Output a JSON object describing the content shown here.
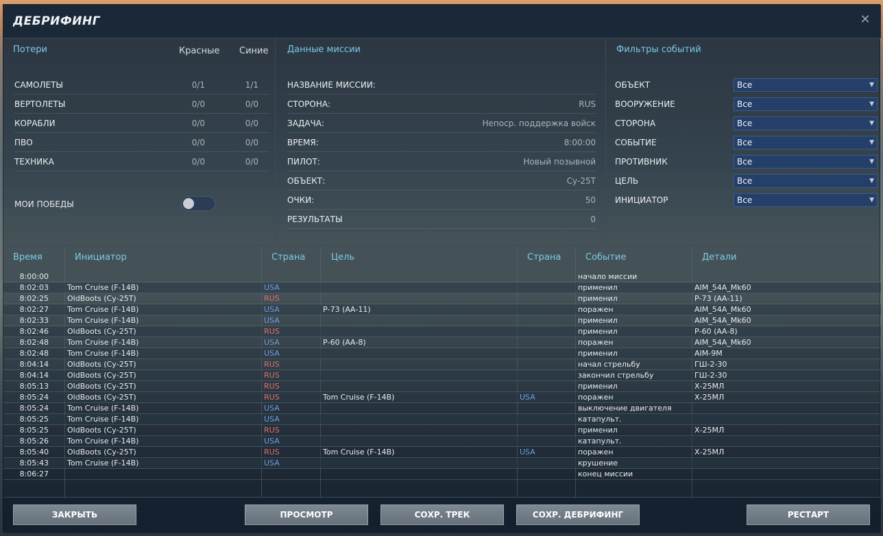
{
  "window": {
    "title": "ДЕБРИФИНГ",
    "close_icon": "close-icon"
  },
  "losses": {
    "header": "Потери",
    "red_label": "Красные",
    "blue_label": "Синие",
    "rows": [
      {
        "label": "САМОЛЕТЫ",
        "red": "0/1",
        "blue": "1/1"
      },
      {
        "label": "ВЕРТОЛЕТЫ",
        "red": "0/0",
        "blue": "0/0"
      },
      {
        "label": "КОРАБЛИ",
        "red": "0/0",
        "blue": "0/0"
      },
      {
        "label": "ПВО",
        "red": "0/0",
        "blue": "0/0"
      },
      {
        "label": "ТЕХНИКА",
        "red": "0/0",
        "blue": "0/0"
      }
    ],
    "my_wins_label": "МОИ ПОБЕДЫ",
    "my_wins_on": false
  },
  "mission": {
    "header": "Данные миссии",
    "rows": [
      {
        "label": "НАЗВАНИЕ МИССИИ:",
        "value": ""
      },
      {
        "label": "СТОРОНА:",
        "value": "RUS"
      },
      {
        "label": "ЗАДАЧА:",
        "value": "Непоср. поддержка войск"
      },
      {
        "label": "ВРЕМЯ:",
        "value": "8:00:00"
      },
      {
        "label": "ПИЛОТ:",
        "value": "Новый позывной"
      },
      {
        "label": "ОБЪЕКТ:",
        "value": "Су-25Т"
      },
      {
        "label": "ОЧКИ:",
        "value": "50"
      },
      {
        "label": "РЕЗУЛЬТАТЫ",
        "value": "0"
      }
    ]
  },
  "filters": {
    "header": "Фильтры событий",
    "rows": [
      {
        "label": "ОБЪЕКТ",
        "value": "Все"
      },
      {
        "label": "ВООРУЖЕНИЕ",
        "value": "Все"
      },
      {
        "label": "СТОРОНА",
        "value": "Все"
      },
      {
        "label": "СОБЫТИЕ",
        "value": "Все"
      },
      {
        "label": "ПРОТИВНИК",
        "value": "Все"
      },
      {
        "label": "ЦЕЛЬ",
        "value": "Все"
      },
      {
        "label": "ИНИЦИАТОР",
        "value": "Все"
      }
    ]
  },
  "events": {
    "headers": {
      "time": "Время",
      "initiator": "Инициатор",
      "country": "Страна",
      "target": "Цель",
      "target_country": "Страна",
      "event": "Событие",
      "details": "Детали"
    },
    "rows": [
      {
        "time": "8:00:00",
        "initiator": "",
        "country": "",
        "target": "",
        "target_country": "",
        "event": "начало миссии",
        "details": ""
      },
      {
        "time": "8:02:03",
        "initiator": "Tom Cruise (F-14B)",
        "country": "USA",
        "target": "",
        "target_country": "",
        "event": "применил",
        "details": "AIM_54A_Mk60"
      },
      {
        "time": "8:02:25",
        "initiator": "OldBoots (Су-25Т)",
        "country": "RUS",
        "target": "",
        "target_country": "",
        "event": "применил",
        "details": "Р-73 (АА-11)"
      },
      {
        "time": "8:02:27",
        "initiator": "Tom Cruise (F-14B)",
        "country": "USA",
        "target": "Р-73 (АА-11)",
        "target_country": "",
        "event": "поражен",
        "details": "AIM_54A_Mk60"
      },
      {
        "time": "8:02:33",
        "initiator": "Tom Cruise (F-14B)",
        "country": "USA",
        "target": "",
        "target_country": "",
        "event": "применил",
        "details": "AIM_54A_Mk60"
      },
      {
        "time": "8:02:46",
        "initiator": "OldBoots (Су-25Т)",
        "country": "RUS",
        "target": "",
        "target_country": "",
        "event": "применил",
        "details": "Р-60 (АА-8)"
      },
      {
        "time": "8:02:48",
        "initiator": "Tom Cruise (F-14B)",
        "country": "USA",
        "target": "Р-60 (АА-8)",
        "target_country": "",
        "event": "поражен",
        "details": "AIM_54A_Mk60"
      },
      {
        "time": "8:02:48",
        "initiator": "Tom Cruise (F-14B)",
        "country": "USA",
        "target": "",
        "target_country": "",
        "event": "применил",
        "details": "AIM-9M"
      },
      {
        "time": "8:04:14",
        "initiator": "OldBoots (Су-25Т)",
        "country": "RUS",
        "target": "",
        "target_country": "",
        "event": "начал стрельбу",
        "details": "ГШ-2-30"
      },
      {
        "time": "8:04:14",
        "initiator": "OldBoots (Су-25Т)",
        "country": "RUS",
        "target": "",
        "target_country": "",
        "event": "закончил стрельбу",
        "details": "ГШ-2-30"
      },
      {
        "time": "8:05:13",
        "initiator": "OldBoots (Су-25Т)",
        "country": "RUS",
        "target": "",
        "target_country": "",
        "event": "применил",
        "details": "Х-25МЛ"
      },
      {
        "time": "8:05:24",
        "initiator": "OldBoots (Су-25Т)",
        "country": "RUS",
        "target": "Tom Cruise (F-14B)",
        "target_country": "USA",
        "event": "поражен",
        "details": "Х-25МЛ"
      },
      {
        "time": "8:05:24",
        "initiator": "Tom Cruise (F-14B)",
        "country": "USA",
        "target": "",
        "target_country": "",
        "event": "выключение двигателя",
        "details": ""
      },
      {
        "time": "8:05:25",
        "initiator": "Tom Cruise (F-14B)",
        "country": "USA",
        "target": "",
        "target_country": "",
        "event": "катапульт.",
        "details": ""
      },
      {
        "time": "8:05:25",
        "initiator": "OldBoots (Су-25Т)",
        "country": "RUS",
        "target": "",
        "target_country": "",
        "event": "применил",
        "details": "Х-25МЛ"
      },
      {
        "time": "8:05:26",
        "initiator": "Tom Cruise (F-14B)",
        "country": "USA",
        "target": "",
        "target_country": "",
        "event": "катапульт.",
        "details": ""
      },
      {
        "time": "8:05:40",
        "initiator": "OldBoots (Су-25Т)",
        "country": "RUS",
        "target": "Tom Cruise (F-14B)",
        "target_country": "USA",
        "event": "поражен",
        "details": "Х-25МЛ"
      },
      {
        "time": "8:05:43",
        "initiator": "Tom Cruise (F-14B)",
        "country": "USA",
        "target": "",
        "target_country": "",
        "event": "крушение",
        "details": ""
      },
      {
        "time": "8:06:27",
        "initiator": "",
        "country": "",
        "target": "",
        "target_country": "",
        "event": "конец миссии",
        "details": ""
      }
    ]
  },
  "buttons": {
    "close": "ЗАКРЫТЬ",
    "view": "ПРОСМОТР",
    "save_track": "СОХР. ТРЕК",
    "save_debrief": "СОХР. ДЕБРИФИНГ",
    "restart": "РЕСТАРТ"
  },
  "colors": {
    "accent": "#7ccbe6",
    "usa": "#6d9fe0",
    "rus": "#e0706a",
    "select_bg": "#24406a"
  }
}
